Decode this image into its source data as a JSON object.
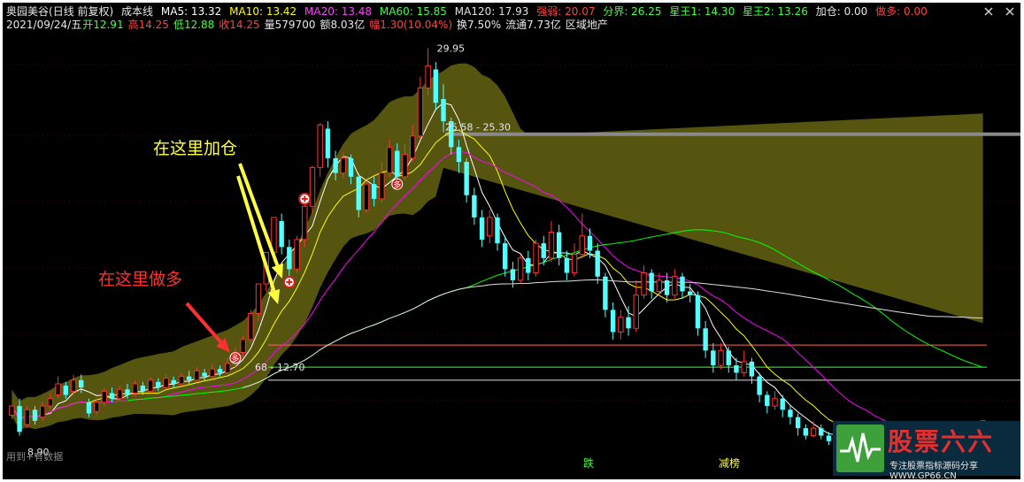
{
  "header": {
    "stock_name": "奥园美谷",
    "period": "(日线 前复权)",
    "indicator_name": "成本线",
    "ma5": "MA5: 13.32",
    "ma10": "MA10: 13.42",
    "ma20": "MA20: 13.48",
    "ma60": "MA60: 15.85",
    "ma120": "MA120: 17.93",
    "strength": "强弱: 20.07",
    "boundary": "分界: 26.25",
    "xingwang1": "星王1: 14.30",
    "xingwang2": "星王2: 13.26",
    "jiacang": "加仓: 0.00",
    "zuoduo": "做多: 0.00",
    "date": "2021/09/24/五",
    "open": "开12.91",
    "high": "高14.25",
    "low": "低12.88",
    "close": "收14.25",
    "volume": "量579700",
    "amount": "额8.03亿",
    "change": "幅1.30(10.04%)",
    "turnover": "换7.50%",
    "float_shares": "流通7.73亿",
    "sector": "区域地产"
  },
  "colors": {
    "ma5": "#ffffff",
    "ma10": "#ffff00",
    "ma20": "#ff00ff",
    "ma60": "#00ff00",
    "ma120": "#e0e0e0",
    "up": "#ff3232",
    "down": "#54ffff",
    "band": "#5a5a10",
    "annotation_red": "#ff3030",
    "annotation_yellow": "#ffff40"
  },
  "icons": {
    "close": "close-icon",
    "logo": "site-logo"
  },
  "annotations": {
    "go_long": "在这里做多",
    "add_position": "在这里加仓"
  },
  "chart_labels": {
    "peak_price": "29.95",
    "upper_range": "25.58 - 25.30",
    "lower_range": "68 - 12.70",
    "low_price": "8.90",
    "signal_duo": "多",
    "signal_die": "跌",
    "signal_jianbang": "减榜"
  },
  "watermark": "用到+有数据",
  "logo": {
    "title": "股票六六",
    "url": "专注股票指标源码分享 WWW.GP66.CN"
  },
  "chart_data": {
    "type": "candlestick",
    "y_range": [
      8.5,
      30.5
    ],
    "candles": [
      [
        10.1,
        10.6,
        10.3,
        9.9
      ],
      [
        10.6,
        9.2,
        11.0,
        9.0
      ],
      [
        9.6,
        10.4,
        10.6,
        9.4
      ],
      [
        10.4,
        9.8,
        10.6,
        9.6
      ],
      [
        10.0,
        10.6,
        10.8,
        9.8
      ],
      [
        10.6,
        11.0,
        11.3,
        10.4
      ],
      [
        11.2,
        11.8,
        12.2,
        11.0
      ],
      [
        11.7,
        11.2,
        11.9,
        11.0
      ],
      [
        11.4,
        12.0,
        12.3,
        11.2
      ],
      [
        12.0,
        11.6,
        12.3,
        11.3
      ],
      [
        10.8,
        10.2,
        11.0,
        10.0
      ],
      [
        10.3,
        10.8,
        11.0,
        10.1
      ],
      [
        10.8,
        11.4,
        11.6,
        10.6
      ],
      [
        11.3,
        11.0,
        11.6,
        10.8
      ],
      [
        11.0,
        11.5,
        11.7,
        10.9
      ],
      [
        11.5,
        11.2,
        11.8,
        11.0
      ],
      [
        11.3,
        11.8,
        12.0,
        11.1
      ],
      [
        11.7,
        11.4,
        11.9,
        11.2
      ],
      [
        11.4,
        12.0,
        12.2,
        11.3
      ],
      [
        11.9,
        11.6,
        12.1,
        11.4
      ],
      [
        11.6,
        12.1,
        12.3,
        11.5
      ],
      [
        12.0,
        11.8,
        12.2,
        11.6
      ],
      [
        11.8,
        12.2,
        12.4,
        11.7
      ],
      [
        12.2,
        12.0,
        12.5,
        11.8
      ],
      [
        12.0,
        12.5,
        12.7,
        11.9
      ],
      [
        12.4,
        12.2,
        12.6,
        12.0
      ],
      [
        12.2,
        12.6,
        12.9,
        12.1
      ],
      [
        12.6,
        12.4,
        12.8,
        12.2
      ],
      [
        12.4,
        12.9,
        13.2,
        12.3
      ],
      [
        12.9,
        13.5,
        13.8,
        12.7
      ],
      [
        13.5,
        14.2,
        14.4,
        13.2
      ],
      [
        14.2,
        15.6,
        15.8,
        14.0
      ],
      [
        15.6,
        17.2,
        17.2,
        15.2
      ],
      [
        17.2,
        18.9,
        18.9,
        16.8
      ],
      [
        18.9,
        20.8,
        20.8,
        18.4
      ],
      [
        20.6,
        19.2,
        21.0,
        18.8
      ],
      [
        19.2,
        18.0,
        19.6,
        17.6
      ],
      [
        18.0,
        19.6,
        19.8,
        17.8
      ],
      [
        19.6,
        21.4,
        21.6,
        19.2
      ],
      [
        21.4,
        23.5,
        23.6,
        21.0
      ],
      [
        23.5,
        25.8,
        25.9,
        23.0
      ],
      [
        25.6,
        24.0,
        26.0,
        23.5
      ],
      [
        24.0,
        23.2,
        24.4,
        22.8
      ],
      [
        23.2,
        24.0,
        24.3,
        22.9
      ],
      [
        24.0,
        23.0,
        24.2,
        22.6
      ],
      [
        23.0,
        21.2,
        23.2,
        20.8
      ],
      [
        21.2,
        22.6,
        22.8,
        21.0
      ],
      [
        22.6,
        21.8,
        23.0,
        21.4
      ],
      [
        21.8,
        23.2,
        23.8,
        21.6
      ],
      [
        23.2,
        24.6,
        25.0,
        23.0
      ],
      [
        24.4,
        23.0,
        24.8,
        22.6
      ],
      [
        23.0,
        24.2,
        24.8,
        22.8
      ],
      [
        24.0,
        25.2,
        25.8,
        23.8
      ],
      [
        25.2,
        27.8,
        28.4,
        25.0
      ],
      [
        27.8,
        29.0,
        29.95,
        27.4
      ],
      [
        28.8,
        27.0,
        29.2,
        26.6
      ],
      [
        27.2,
        26.0,
        28.0,
        25.4
      ],
      [
        26.0,
        24.6,
        26.2,
        24.2
      ],
      [
        24.6,
        23.8,
        25.0,
        23.2
      ],
      [
        23.8,
        22.0,
        24.0,
        21.6
      ],
      [
        22.0,
        20.8,
        22.4,
        20.4
      ],
      [
        20.8,
        19.6,
        21.2,
        19.2
      ],
      [
        19.8,
        20.8,
        21.2,
        19.4
      ],
      [
        20.8,
        19.4,
        21.0,
        19.0
      ],
      [
        19.4,
        18.0,
        19.8,
        17.6
      ],
      [
        18.0,
        17.4,
        18.4,
        17.0
      ],
      [
        17.4,
        18.6,
        18.8,
        17.2
      ],
      [
        18.6,
        17.8,
        19.0,
        17.4
      ],
      [
        17.8,
        19.4,
        19.6,
        17.6
      ],
      [
        19.4,
        18.6,
        19.8,
        18.2
      ],
      [
        18.6,
        20.0,
        20.6,
        18.4
      ],
      [
        20.0,
        18.6,
        20.4,
        18.2
      ],
      [
        18.6,
        17.8,
        19.0,
        17.4
      ],
      [
        17.8,
        18.8,
        19.4,
        17.6
      ],
      [
        18.8,
        19.8,
        21.0,
        18.6
      ],
      [
        19.8,
        19.0,
        20.2,
        18.6
      ],
      [
        19.0,
        17.6,
        19.4,
        17.2
      ],
      [
        17.6,
        15.8,
        17.8,
        15.4
      ],
      [
        15.8,
        14.6,
        16.2,
        14.2
      ],
      [
        14.6,
        15.4,
        15.8,
        14.2
      ],
      [
        15.4,
        14.8,
        16.0,
        14.4
      ],
      [
        14.8,
        16.6,
        17.4,
        14.6
      ],
      [
        16.6,
        17.8,
        18.2,
        16.4
      ],
      [
        17.8,
        16.8,
        18.0,
        16.4
      ],
      [
        16.8,
        17.4,
        17.8,
        16.6
      ],
      [
        17.4,
        16.6,
        17.8,
        16.2
      ],
      [
        16.6,
        17.6,
        18.0,
        16.4
      ],
      [
        17.6,
        16.8,
        17.8,
        16.4
      ],
      [
        16.8,
        16.6,
        17.2,
        16.2
      ],
      [
        16.6,
        14.8,
        16.8,
        14.4
      ],
      [
        14.8,
        13.6,
        15.2,
        13.2
      ],
      [
        13.6,
        12.8,
        14.0,
        12.4
      ],
      [
        12.8,
        13.6,
        14.0,
        12.6
      ],
      [
        13.6,
        12.8,
        13.8,
        12.4
      ],
      [
        12.8,
        12.4,
        13.2,
        12.0
      ],
      [
        12.4,
        13.0,
        13.6,
        12.2
      ],
      [
        13.0,
        12.2,
        13.2,
        11.8
      ],
      [
        12.2,
        11.2,
        12.4,
        10.8
      ],
      [
        11.2,
        10.6,
        11.4,
        10.2
      ],
      [
        10.6,
        11.0,
        11.4,
        10.4
      ],
      [
        11.0,
        10.4,
        11.2,
        10.0
      ],
      [
        10.4,
        10.0,
        10.6,
        9.6
      ],
      [
        10.0,
        9.4,
        10.2,
        9.0
      ],
      [
        9.4,
        9.0,
        9.6,
        8.8
      ],
      [
        9.0,
        9.4,
        9.8,
        8.9
      ],
      [
        9.4,
        9.0,
        9.6,
        8.8
      ],
      [
        9.0,
        8.7,
        9.2,
        8.5
      ],
      [
        8.7,
        9.1,
        9.4,
        8.6
      ],
      [
        9.1,
        8.8,
        9.3,
        8.6
      ],
      [
        8.8,
        8.5,
        9.0,
        8.3
      ],
      [
        8.5,
        8.9,
        9.2,
        8.4
      ],
      [
        8.9,
        8.6,
        9.1,
        8.4
      ],
      [
        8.6,
        8.3,
        8.8,
        8.1
      ],
      [
        8.3,
        8.7,
        8.9,
        8.2
      ],
      [
        8.7,
        8.4,
        8.9,
        8.2
      ],
      [
        8.4,
        8.1,
        8.6,
        7.9
      ],
      [
        8.1,
        8.6,
        8.8,
        8.0
      ],
      [
        8.6,
        9.0,
        9.4,
        8.5
      ],
      [
        9.0,
        8.8,
        9.2,
        8.6
      ],
      [
        8.8,
        8.6,
        9.0,
        8.4
      ],
      [
        8.6,
        9.0,
        9.2,
        8.5
      ],
      [
        9.0,
        8.7,
        9.1,
        8.5
      ],
      [
        8.7,
        8.5,
        8.9,
        8.3
      ],
      [
        8.5,
        8.4,
        8.6,
        8.2
      ],
      [
        8.4,
        8.2,
        8.5,
        8.0
      ],
      [
        8.2,
        8.3,
        8.5,
        8.1
      ],
      [
        8.3,
        9.8,
        9.8,
        8.2
      ]
    ]
  }
}
